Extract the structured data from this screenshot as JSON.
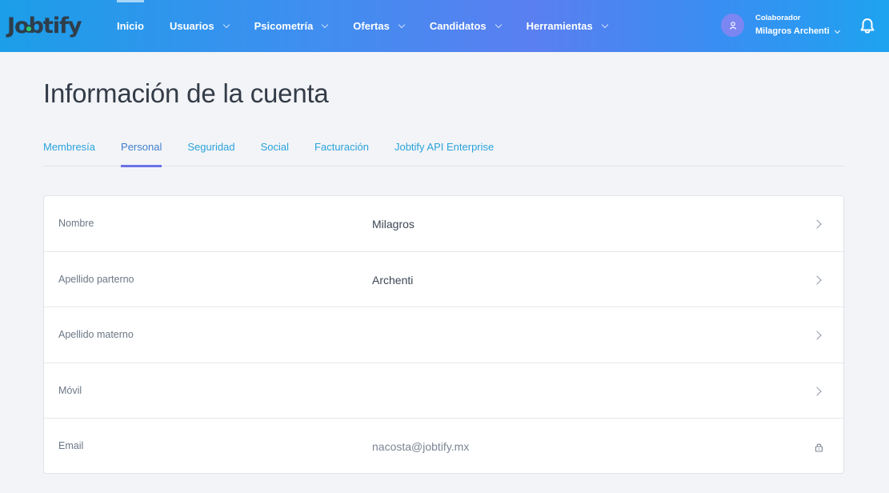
{
  "app": {
    "logo_text": "Jobtify",
    "accent": "#6b72e8",
    "link_color": "#2aa3dc"
  },
  "nav": {
    "items": [
      {
        "label": "Inicio",
        "dropdown": false,
        "active": true
      },
      {
        "label": "Usuarios",
        "dropdown": true
      },
      {
        "label": "Psicometría",
        "dropdown": true
      },
      {
        "label": "Ofertas",
        "dropdown": true
      },
      {
        "label": "Candidatos",
        "dropdown": true
      },
      {
        "label": "Herramientas",
        "dropdown": true
      }
    ]
  },
  "user": {
    "role": "Colaborador",
    "name": "Milagros Archenti",
    "avatar_icon": "user-icon",
    "notifications_icon": "bell-icon"
  },
  "page": {
    "title": "Información de la cuenta"
  },
  "tabs": [
    {
      "label": "Membresía"
    },
    {
      "label": "Personal",
      "active": true
    },
    {
      "label": "Seguridad"
    },
    {
      "label": "Social"
    },
    {
      "label": "Facturación"
    },
    {
      "label": "Jobtify API Enterprise"
    }
  ],
  "fields": [
    {
      "label": "Nombre",
      "value": "Milagros",
      "editable": true
    },
    {
      "label": "Apellido parterno",
      "value": "Archenti",
      "editable": true
    },
    {
      "label": "Apellido materno",
      "value": "",
      "editable": true
    },
    {
      "label": "Móvil",
      "value": "",
      "editable": true
    },
    {
      "label": "Email",
      "value": "nacosta@jobtify.mx",
      "editable": false,
      "icon": "lock-icon"
    }
  ]
}
